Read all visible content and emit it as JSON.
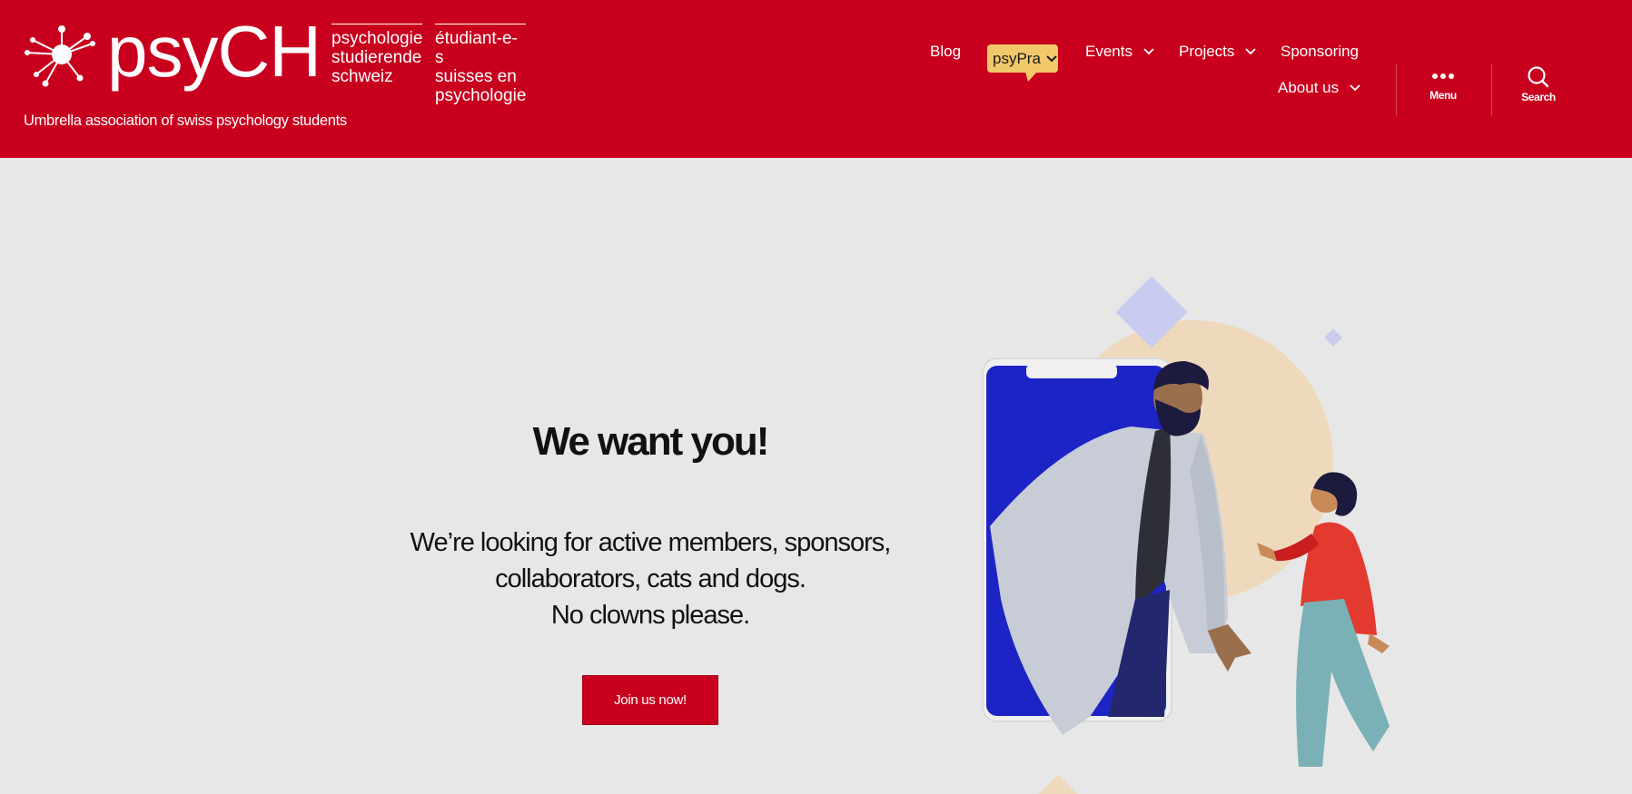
{
  "brand": {
    "word": "psyCH",
    "de_lines": [
      "psychologie",
      "studierende",
      "schweiz"
    ],
    "fr_lines": [
      "étudiant-e-s",
      "suisses en",
      "psychologie"
    ],
    "tagline": "Umbrella association of swiss psychology students",
    "color": "#c8001e"
  },
  "nav": {
    "blog": "Blog",
    "psypra": "psyPra",
    "events": "Events",
    "projects": "Projects",
    "sponsoring": "Sponsoring",
    "about": "About us"
  },
  "tools": {
    "menu": "Menu",
    "search": "Search"
  },
  "hero": {
    "title": "We want you!",
    "lines": [
      "We’re looking for active members, sponsors,",
      "collaborators, cats and dogs.",
      "No clowns please."
    ],
    "cta": "Join us now!"
  },
  "icons": [
    "network-logo-icon",
    "chevron-down-icon",
    "ellipsis-icon",
    "search-icon"
  ],
  "colors": {
    "header": "#c8001e",
    "page": "#e8e7e7",
    "psypra_badge": "#f2c96a"
  }
}
